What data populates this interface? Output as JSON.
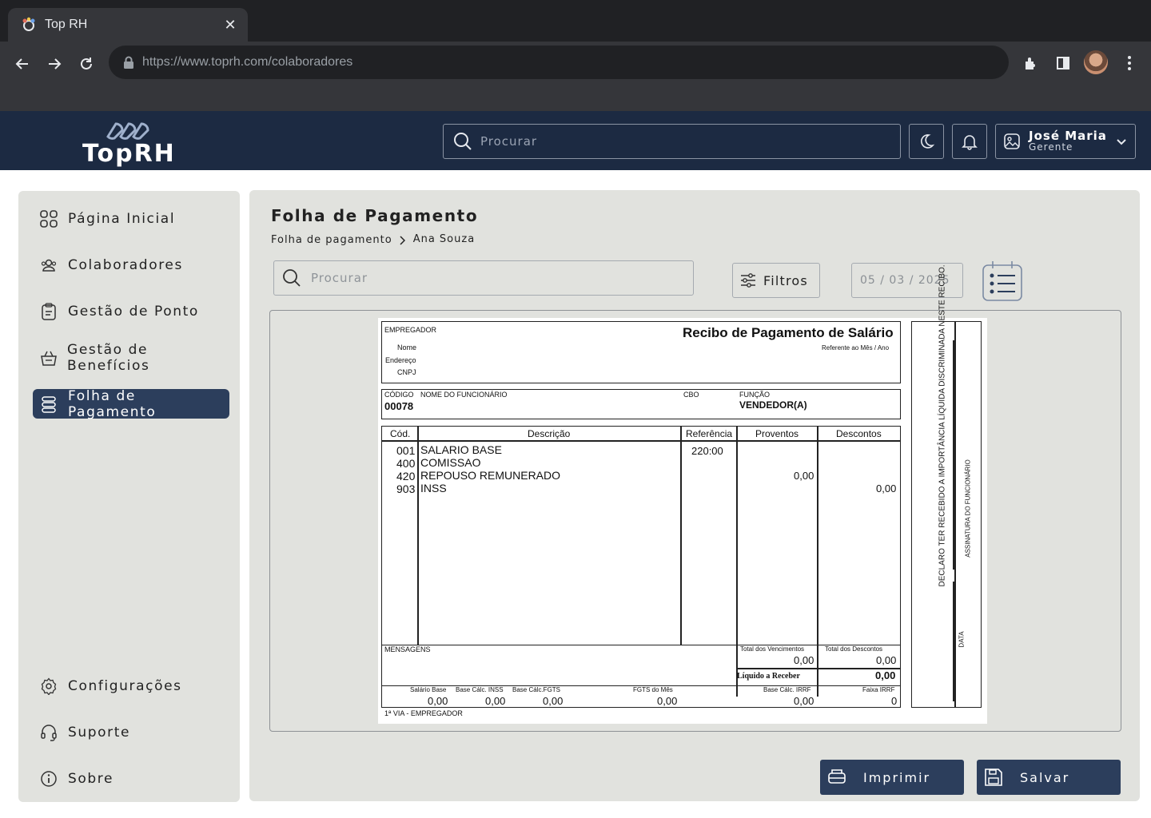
{
  "browser": {
    "tab_title": "Top RH",
    "url_host": "https://www.toprh.com",
    "url_path": "/colaboradores"
  },
  "header": {
    "logo_text": "TopRH",
    "search_placeholder": "Procurar",
    "user_name": "José Maria",
    "user_role": "Gerente"
  },
  "sidebar": {
    "items": [
      {
        "label": "Página Inicial",
        "icon": "grid-icon"
      },
      {
        "label": "Colaboradores",
        "icon": "users-icon"
      },
      {
        "label": "Gestão de Ponto",
        "icon": "clipboard-icon"
      },
      {
        "label": "Gestão de Benefícios",
        "icon": "basket-icon"
      },
      {
        "label": "Folha de Pagamento",
        "icon": "coins-icon",
        "active": true
      }
    ],
    "bottom_items": [
      {
        "label": "Configurações",
        "icon": "gear-icon"
      },
      {
        "label": "Suporte",
        "icon": "headset-icon"
      },
      {
        "label": "Sobre",
        "icon": "info-icon"
      }
    ]
  },
  "main": {
    "title": "Folha de Pagamento",
    "breadcrumb": [
      "Folha de pagamento",
      "Ana Souza"
    ],
    "search_placeholder": "Procurar",
    "filter_label": "Filtros",
    "date": "05 / 03 / 2025",
    "print_label": "Imprimir",
    "save_label": "Salvar"
  },
  "receipt": {
    "employer_label": "EMPREGADOR",
    "title": "Recibo de Pagamento de Salário",
    "ref_label": "Referente ao Mês / Ano",
    "nome_label": "Nome",
    "endereco_label": "Endereço",
    "cnpj_label": "CNPJ",
    "codigo_label": "CÓDIGO",
    "nome_func_label": "NOME DO FUNCIONÁRIO",
    "cbo_label": "CBO",
    "funcao_label": "FUNÇÃO",
    "codigo": "00078",
    "funcao": "VENDEDOR(A)",
    "col_cod": "Cód.",
    "col_desc": "Descrição",
    "col_ref": "Referência",
    "col_prov": "Proventos",
    "col_desc2": "Descontos",
    "rows": [
      {
        "cod": "001",
        "desc": "SALARIO BASE",
        "ref": "220:00",
        "prov": "",
        "descontos": ""
      },
      {
        "cod": "400",
        "desc": "COMISSAO",
        "ref": "",
        "prov": "",
        "descontos": ""
      },
      {
        "cod": "420",
        "desc": "REPOUSO REMUNERADO",
        "ref": "",
        "prov": "0,00",
        "descontos": ""
      },
      {
        "cod": "903",
        "desc": "INSS",
        "ref": "",
        "prov": "",
        "descontos": "0,00"
      }
    ],
    "mensagens_label": "MENSAGENS",
    "total_venc_label": "Total dos Vencimentos",
    "total_venc": "0,00",
    "total_desc_label": "Total dos Descontos",
    "total_desc": "0,00",
    "liquido_label": "Líquido a Receber",
    "liquido": "0,00",
    "salario_base_label": "Salário Base",
    "salario_base": "0,00",
    "base_inss_label": "Base Cálc. INSS",
    "base_inss": "0,00",
    "base_fgts_label": "Base Cálc.FGTS",
    "base_fgts": "0,00",
    "fgts_mes_label": "FGTS do Mês",
    "fgts_mes": "0,00",
    "base_irrf_label": "Base Cálc. IRRF",
    "base_irrf": "0,00",
    "faixa_irrf_label": "Faixa IRRF",
    "faixa_irrf": "0",
    "via_label": "1ª VIA - EMPREGADOR",
    "declaro_text": "DECLARO TER RECEBIDO A IMPORTÂNCIA LÍQUIDA DISCRIMINADA NESTE RECIBO.",
    "assinatura_label": "ASSINATURA DO FUNCIONÁRIO",
    "data_label": "DATA"
  },
  "colors": {
    "chrome_dark": "#202124",
    "header_navy": "#1c2a42",
    "panel_gray": "#e1e2de",
    "active_blue": "#2c3e5c"
  }
}
